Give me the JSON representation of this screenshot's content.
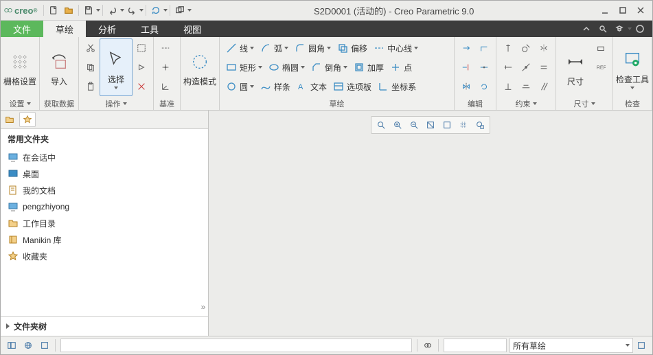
{
  "app": {
    "name": "creo",
    "title": "S2D0001 (活动的) - Creo Parametric 9.0"
  },
  "tabs": {
    "file": "文件",
    "sketch": "草绘",
    "analysis": "分析",
    "tools": "工具",
    "view": "视图"
  },
  "ribbon": {
    "grid": {
      "btn": "栅格设置",
      "label": "设置"
    },
    "import": {
      "btn": "导入",
      "label": "获取数据"
    },
    "select": {
      "btn": "选择",
      "label": "操作"
    },
    "datum": {
      "label": "基准"
    },
    "construct": {
      "btn": "构造模式"
    },
    "sketch": {
      "label": "草绘",
      "line": "线",
      "arc": "弧",
      "fillet": "圆角",
      "offset": "偏移",
      "centerline": "中心线",
      "rect": "矩形",
      "ellipse": "椭圆",
      "chamfer": "倒角",
      "thicken": "加厚",
      "point": "点",
      "circle": "圆",
      "spline": "样条",
      "text": "文本",
      "palette": "选项板",
      "csys": "坐标系"
    },
    "edit": {
      "label": "编辑"
    },
    "constrain": {
      "label": "约束"
    },
    "dim": {
      "btn": "尺寸",
      "label": "尺寸"
    },
    "inspect": {
      "btn": "检查工具",
      "label": "检查"
    }
  },
  "folders": {
    "header": "常用文件夹",
    "items": [
      {
        "label": "在会话中",
        "icon": "monitor"
      },
      {
        "label": "桌面",
        "icon": "desktop"
      },
      {
        "label": "我的文档",
        "icon": "docs"
      },
      {
        "label": "pengzhiyong",
        "icon": "monitor"
      },
      {
        "label": "工作目录",
        "icon": "folder"
      },
      {
        "label": "Manikin 库",
        "icon": "lib"
      },
      {
        "label": "收藏夹",
        "icon": "star"
      }
    ],
    "tree": "文件夹树"
  },
  "status": {
    "filter": "所有草绘"
  }
}
